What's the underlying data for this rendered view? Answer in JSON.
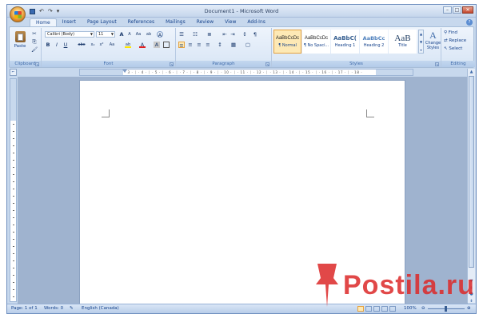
{
  "window": {
    "title": "Document1 - Microsoft Word",
    "controls": {
      "minimize": "–",
      "maximize": "□",
      "close": "✕"
    }
  },
  "qat": {
    "save_icon": "save-icon",
    "undo": "↶",
    "redo": "↷",
    "customize": "▾"
  },
  "tabs": [
    "Home",
    "Insert",
    "Page Layout",
    "References",
    "Mailings",
    "Review",
    "View",
    "Add-Ins"
  ],
  "help": "?",
  "ribbon": {
    "clipboard": {
      "label": "Clipboard",
      "paste_label": "Paste",
      "cut": "✂",
      "copy": "⎘",
      "format_painter": "🖌"
    },
    "font": {
      "label": "Font",
      "family": "Calibri (Body)",
      "size": "11",
      "grow": "A",
      "shrink": "A",
      "clear": "Aa",
      "phonetic": "ab",
      "bold": "B",
      "italic": "I",
      "underline": "U",
      "strike": "abc",
      "subscript": "x₂",
      "superscript": "x²",
      "change_case": "Aa",
      "highlight": "ab",
      "font_color": "A",
      "char_shade": "A",
      "enclose": "A"
    },
    "paragraph": {
      "label": "Paragraph",
      "bullets": "☰",
      "numbering": "☷",
      "multilevel": "≣",
      "decrease_indent": "⇤",
      "increase_indent": "⇥",
      "sort": "↕",
      "pilcrow": "¶",
      "align_left": "≡",
      "center": "≡",
      "align_right": "≡",
      "justify": "≡",
      "line_spacing": "↕",
      "shading": "▦",
      "borders": "▢"
    },
    "styles": {
      "label": "Styles",
      "items": [
        {
          "preview": "AaBbCcDc",
          "name": "¶ Normal",
          "selected": true
        },
        {
          "preview": "AaBbCcDc",
          "name": "¶ No Spaci...",
          "selected": false
        },
        {
          "preview": "AaBbC(",
          "name": "Heading 1",
          "selected": false
        },
        {
          "preview": "AaBbCc",
          "name": "Heading 2",
          "selected": false
        },
        {
          "preview": "AaB",
          "name": "Title",
          "selected": false
        }
      ],
      "change_styles": "Change Styles"
    },
    "editing": {
      "label": "Editing",
      "find": "Find",
      "replace": "Replace",
      "select": "Select"
    }
  },
  "ruler": {
    "horizontal": "· 1 · ⏐ · 1 · ⏐ · 2 · ⏐ · 3 · ⏐ · 4 · ⏐ · 5 · ⏐ · 6 · ⏐ · 7 · ⏐ · 8 · ⏐ · 9 · ⏐ · 10 · ⏐ · 11 · ⏐ · 12 · ⏐ · 13 · ⏐ · 14 · ⏐ · 15 · ⏐ · 16 · ⏐ · 17 · ⏐ · 18 ·"
  },
  "statusbar": {
    "page": "Page: 1 of 1",
    "words": "Words: 0",
    "language": "English (Canada)",
    "zoom": "100%",
    "zoom_level": 1.0
  },
  "watermark": {
    "text": "Postila.ru"
  }
}
